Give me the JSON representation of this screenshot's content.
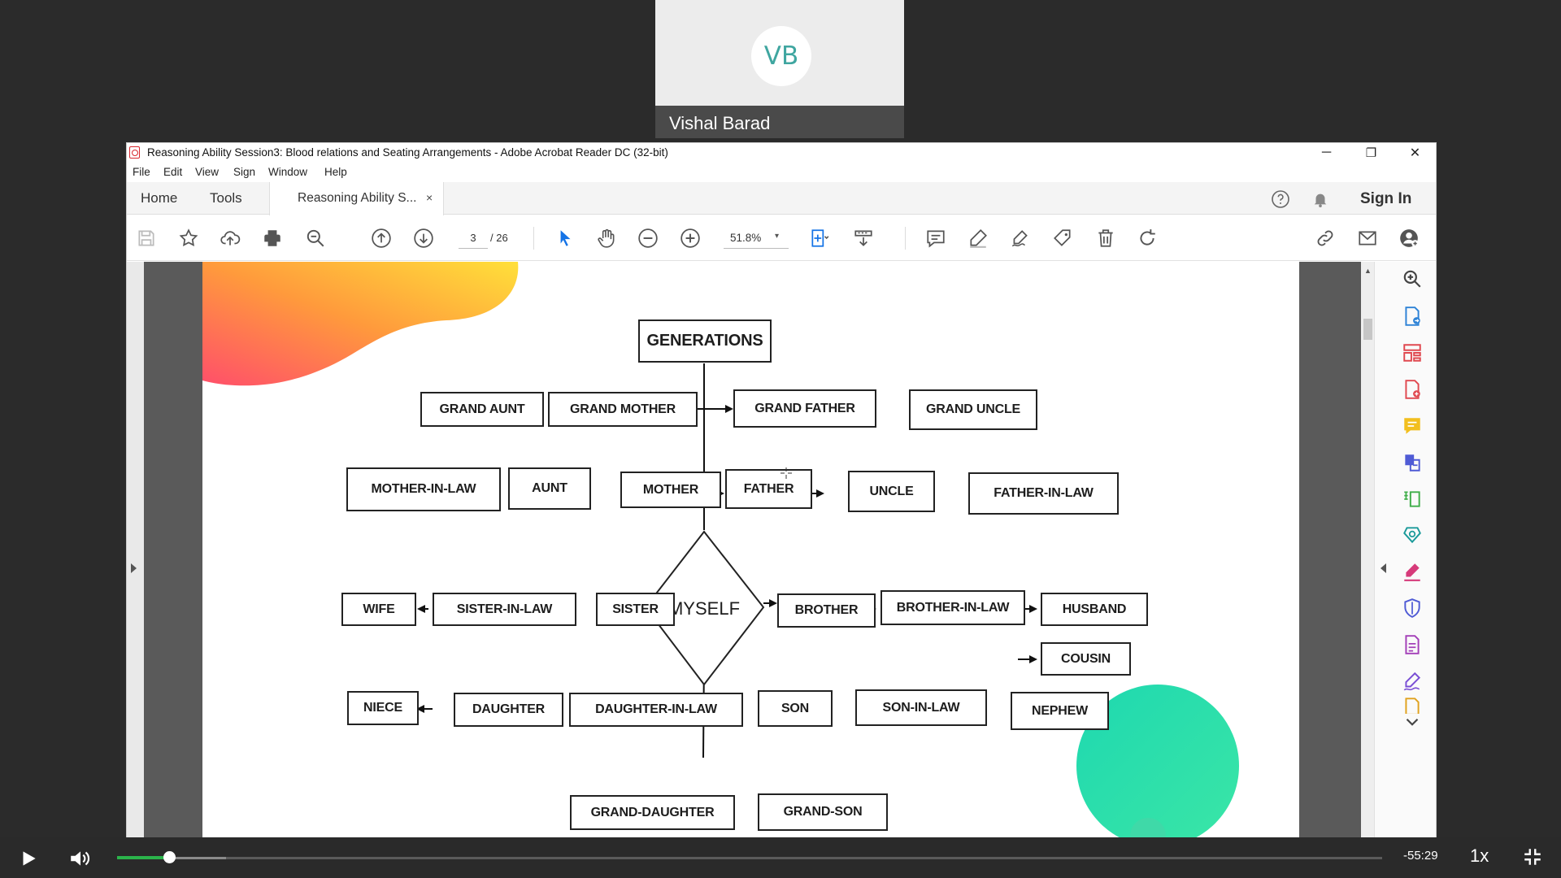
{
  "meeting": {
    "participant_initials": "VB",
    "participant_name": "Vishal Barad"
  },
  "window": {
    "title": "Reasoning Ability Session3: Blood relations and Seating Arrangements - Adobe Acrobat Reader DC (32-bit)",
    "minimize": "─",
    "restore": "❐",
    "close": "✕"
  },
  "menu": [
    "File",
    "Edit",
    "View",
    "Sign",
    "Window",
    "Help"
  ],
  "tabs": {
    "home": "Home",
    "tools": "Tools",
    "document": "Reasoning Ability S...",
    "close": "×"
  },
  "header_right": {
    "sign_in": "Sign In"
  },
  "toolbar": {
    "current_page": "3",
    "total_pages": "/  26",
    "zoom": "51.8%",
    "zoom_caret": "▾"
  },
  "diagram": {
    "title": "GENERATIONS",
    "center": "MYSELF",
    "nodes": {
      "grand_aunt": "GRAND AUNT",
      "grand_mother": "GRAND MOTHER",
      "grand_father": "GRAND FATHER",
      "grand_uncle": "GRAND UNCLE",
      "mother_in_law": "MOTHER-IN-LAW",
      "aunt": "AUNT",
      "mother": "MOTHER",
      "father": "FATHER",
      "uncle": "UNCLE",
      "father_in_law": "FATHER-IN-LAW",
      "wife": "WIFE",
      "sister_in_law": "SISTER-IN-LAW",
      "sister": "SISTER",
      "brother": "BROTHER",
      "brother_in_law": "BROTHER-IN-LAW",
      "husband": "HUSBAND",
      "cousin": "COUSIN",
      "niece": "NIECE",
      "daughter": "DAUGHTER",
      "daughter_in_law": "DAUGHTER-IN-LAW",
      "son": "SON",
      "son_in_law": "SON-IN-LAW",
      "nephew": "NEPHEW",
      "grand_daughter": "GRAND-DAUGHTER",
      "grand_son": "GRAND-SON"
    }
  },
  "player": {
    "time_remaining": "-55:29",
    "speed": "1x",
    "progress_fraction": 0.04
  },
  "colors": {
    "accent_green": "#2bb44b",
    "acrobat_red": "#d8272d",
    "select_blue": "#1473e6",
    "teal_avatar": "#3fa6a0"
  }
}
